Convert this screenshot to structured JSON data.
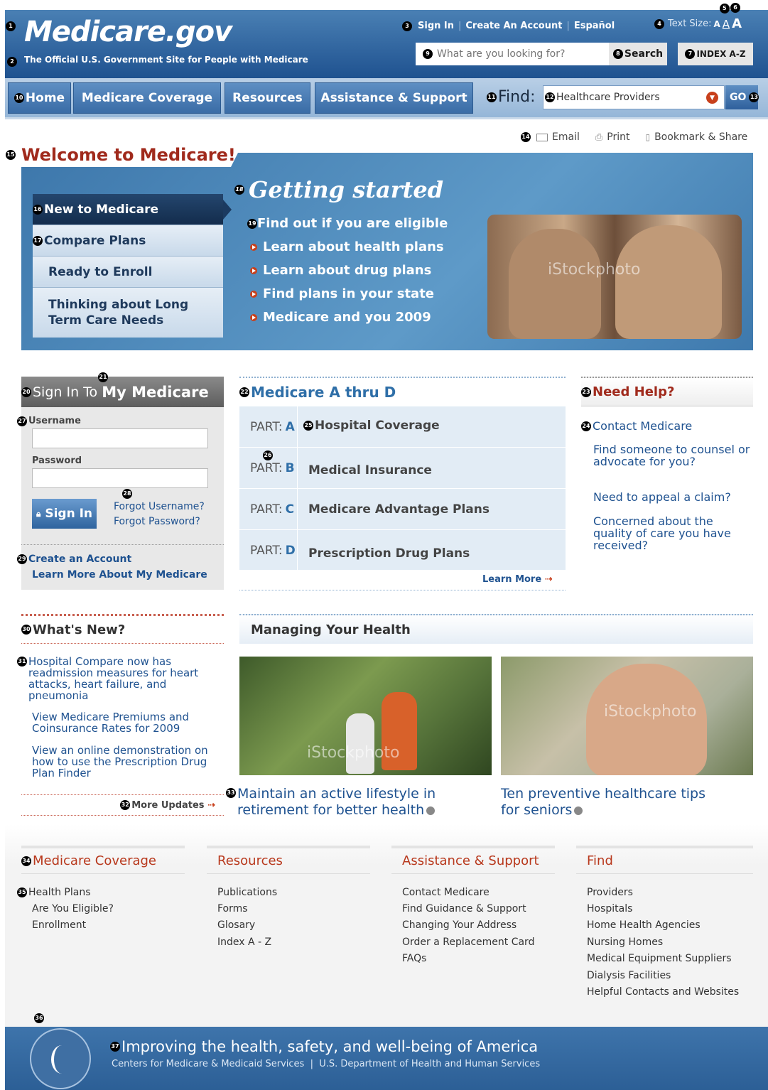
{
  "header": {
    "logo": "Medicare.gov",
    "tagline": "The Official U.S. Government Site for People with Medicare",
    "sign_in": "Sign In",
    "create_account": "Create An Account",
    "espanol": "Español",
    "text_size_label": "Text Size:",
    "text_size_small": "A",
    "text_size_medium": "A",
    "text_size_large": "A",
    "search_placeholder": "What are you looking for?",
    "search_button": "Search",
    "index_button": "INDEX A-Z"
  },
  "nav": {
    "tabs": [
      "Home",
      "Medicare Coverage",
      "Resources",
      "Assistance & Support"
    ],
    "find_label": "Find:",
    "find_value": "Healthcare Providers",
    "go_button": "GO"
  },
  "utilities": {
    "email": "Email",
    "print": "Print",
    "bookmark": "Bookmark & Share"
  },
  "welcome": "Welcome to Medicare!",
  "hero": {
    "menu": [
      "New to Medicare",
      "Compare Plans",
      "Ready to Enroll",
      "Thinking about Long Term Care Needs"
    ],
    "title": "Getting started",
    "links": [
      "Find out if you are eligible",
      "Learn about health plans",
      "Learn about drug plans",
      "Find plans in your state",
      "Medicare and you 2009"
    ],
    "photo_watermark": "iStockphoto"
  },
  "signin": {
    "heading_prefix": "Sign In To",
    "heading_bold": "My Medicare",
    "username_label": "Username",
    "password_label": "Password",
    "button": "Sign In",
    "forgot_username": "Forgot Username?",
    "forgot_password": "Forgot Password?",
    "create_account": "Create an Account",
    "learn_more": "Learn More About My Medicare"
  },
  "parts": {
    "heading": "Medicare A thru D",
    "part_label": "PART:",
    "rows": [
      {
        "letter": "A",
        "desc": "Hospital Coverage"
      },
      {
        "letter": "B",
        "desc": "Medical Insurance"
      },
      {
        "letter": "C",
        "desc": "Medicare Advantage Plans"
      },
      {
        "letter": "D",
        "desc": "Prescription Drug Plans"
      }
    ],
    "learn_more": "Learn More"
  },
  "help": {
    "heading": "Need Help?",
    "contact": "Contact Medicare",
    "links": [
      "Find someone to counsel or advocate for you?",
      "Need to appeal a claim?",
      "Concerned about the quality of care you have received?"
    ]
  },
  "news": {
    "heading": "What's New?",
    "items": [
      "Hospital Compare now has readmission measures for heart attacks, heart failure, and pneumonia",
      "View Medicare Premiums and Coinsurance Rates for 2009",
      "View an online demonstration on how to use the Prescription Drug Plan Finder"
    ],
    "more": "More Updates"
  },
  "health": {
    "heading": "Managing Your Health",
    "items": [
      {
        "caption": "Maintain an active lifestyle in retirement for better health",
        "watermark": "iStockphoto"
      },
      {
        "caption": "Ten preventive healthcare tips for seniors",
        "watermark": "iStockphoto"
      }
    ]
  },
  "footer": {
    "columns": [
      {
        "title": "Medicare Coverage",
        "links": [
          "Health Plans",
          "Are You Eligible?",
          "Enrollment"
        ]
      },
      {
        "title": "Resources",
        "links": [
          "Publications",
          "Forms",
          "Glosary",
          "Index A - Z"
        ]
      },
      {
        "title": "Assistance & Support",
        "links": [
          "Contact Medicare",
          "Find Guidance & Support",
          "Changing Your Address",
          "Order a Replacement Card",
          "FAQs"
        ]
      },
      {
        "title": "Find",
        "links": [
          "Providers",
          "Hospitals",
          "Home Health Agencies",
          "Nursing Homes",
          "Medical Equipment Suppliers",
          "Dialysis Facilities",
          "Helpful Contacts and Websites"
        ]
      }
    ],
    "tagline": "Improving the health, safety, and well-being of America",
    "agencies": "Centers for Medicare & Medicaid Services  |  U.S. Department of Health and Human Services"
  },
  "markers": [
    "1",
    "2",
    "3",
    "4",
    "5",
    "6",
    "7",
    "8",
    "9",
    "10",
    "11",
    "12",
    "13",
    "14",
    "15",
    "16",
    "17",
    "18",
    "19",
    "20",
    "21",
    "22",
    "23",
    "24",
    "25",
    "26",
    "27",
    "28",
    "29",
    "30",
    "31",
    "32",
    "33",
    "34",
    "35",
    "36",
    "37"
  ],
  "colors": {
    "brand_blue": "#1f5290",
    "accent_red": "#a02a1c",
    "nav_blue": "#3a6ca6"
  }
}
